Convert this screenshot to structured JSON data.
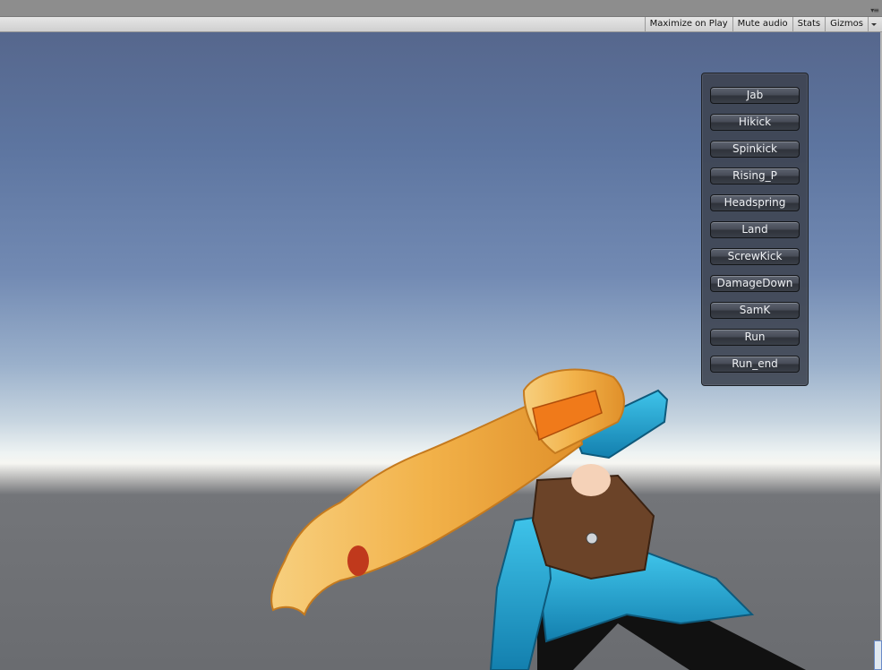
{
  "toolbar": {
    "maximize_label": "Maximize on Play",
    "mute_label": "Mute audio",
    "stats_label": "Stats",
    "gizmos_label": "Gizmos"
  },
  "scene": {
    "sky_top_color": "#56678d",
    "horizon_color": "#f6f6f2",
    "ground_color": "#6a6c70"
  },
  "action_panel": {
    "buttons": [
      {
        "label": "Jab"
      },
      {
        "label": "Hikick"
      },
      {
        "label": "Spinkick"
      },
      {
        "label": "Rising_P"
      },
      {
        "label": "Headspring"
      },
      {
        "label": "Land"
      },
      {
        "label": "ScrewKick"
      },
      {
        "label": "DamageDown"
      },
      {
        "label": "SamK"
      },
      {
        "label": "Run"
      },
      {
        "label": "Run_end"
      }
    ]
  },
  "character": {
    "hair_color": "#f2b24a",
    "outfit_color": "#1fa3cf",
    "vest_color": "#6b4328"
  }
}
